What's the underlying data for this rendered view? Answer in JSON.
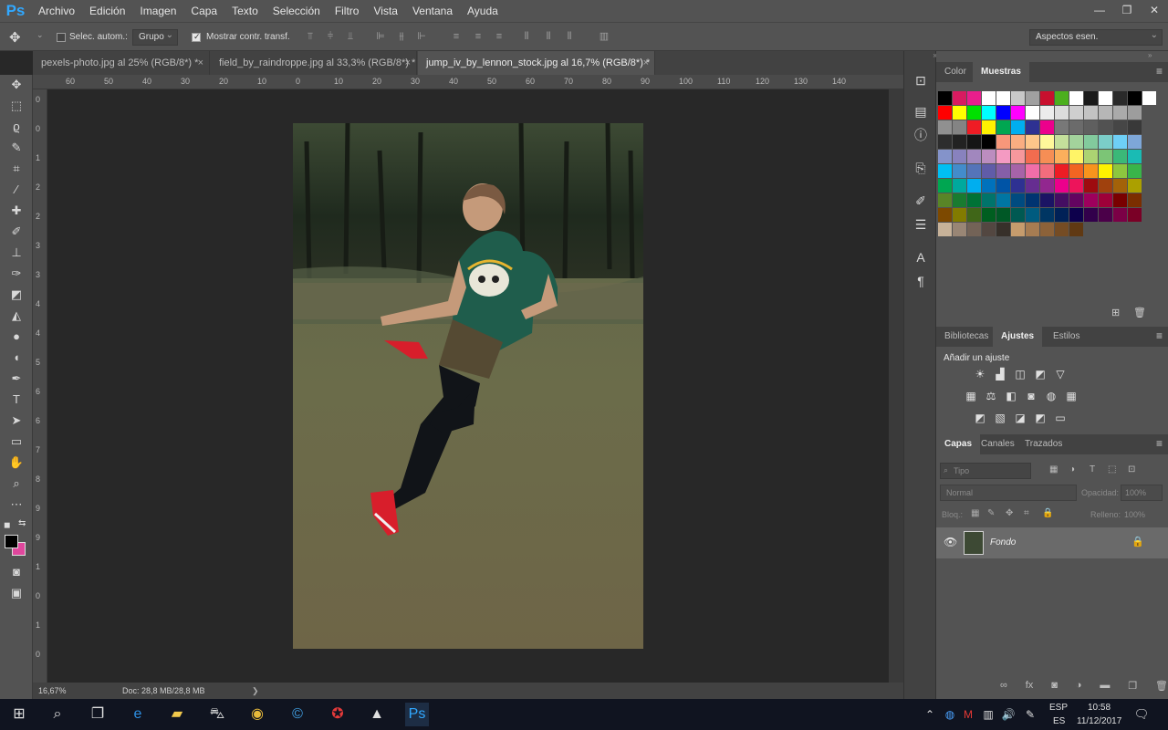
{
  "app": {
    "logo": "Ps",
    "menus": [
      "Archivo",
      "Edición",
      "Imagen",
      "Capa",
      "Texto",
      "Selección",
      "Filtro",
      "Vista",
      "Ventana",
      "Ayuda"
    ],
    "win_min": "—",
    "win_max": "❐",
    "win_close": "✕"
  },
  "options": {
    "auto_select_label": "Selec. autom.:",
    "auto_select_value": "Grupo",
    "show_transform_label": "Mostrar contr. transf.",
    "workspace": "Aspectos esen."
  },
  "tabs": [
    {
      "label": "pexels-photo.jpg al 25% (RGB/8*) *"
    },
    {
      "label": "field_by_raindroppe.jpg al 33,3% (RGB/8*) *"
    },
    {
      "label": "jump_iv_by_lennon_stock.jpg al 16,7% (RGB/8*) *"
    }
  ],
  "tab_close": "×",
  "ruler_h": [
    "60",
    "50",
    "40",
    "30",
    "20",
    "10",
    "0",
    "10",
    "20",
    "30",
    "40",
    "50",
    "60",
    "70",
    "80",
    "90",
    "100",
    "110",
    "120",
    "130",
    "140"
  ],
  "ruler_v": [
    "0",
    "0",
    "1",
    "2",
    "2",
    "3",
    "3",
    "4",
    "4",
    "5",
    "6",
    "6",
    "7",
    "8",
    "9",
    "9",
    "1",
    "0",
    "1",
    "0"
  ],
  "status": {
    "zoom": "16,67%",
    "doc": "Doc: 28,8 MB/28,8 MB",
    "arrow": "❯"
  },
  "colors": {
    "foreground": "#000000",
    "background": "#e0479d"
  },
  "swatches_panel": {
    "tabs": [
      "Color",
      "Muestras"
    ],
    "active": "Muestras"
  },
  "swatches": [
    [
      "#000000",
      "#d81b60",
      "#e91e8c",
      "#ffffff",
      "#ffffff",
      "#c8c8c8",
      "#a0a0a0",
      "#c8102e",
      "#4caf1e",
      "#ffffff",
      "#1a1a1a",
      "#ffffff",
      "#2a2a2a",
      "#000000",
      "#ffffff"
    ],
    [
      "#ff0000",
      "#ffff00",
      "#00e000",
      "#00ffff",
      "#0000ff",
      "#ff00ff",
      "#ffffff",
      "#ececec",
      "#dcdcdc",
      "#cfcfcf",
      "#c3c3c3",
      "#b6b6b6",
      "#aaaaaa",
      "#9d9d9d"
    ],
    [
      "#909090",
      "#848484",
      "#ef1c24",
      "#fff200",
      "#00a651",
      "#00aeef",
      "#2e3192",
      "#ec008c",
      "#787878",
      "#6b6b6b",
      "#5f5f5f",
      "#525252",
      "#464646",
      "#393939"
    ],
    [
      "#2d2d2d",
      "#222222",
      "#151515",
      "#000000",
      "#f7977a",
      "#f9ad81",
      "#fdc68a",
      "#fff79a",
      "#c4df9b",
      "#a3d39c",
      "#82ca9d",
      "#7bcdc8",
      "#6ecff6",
      "#7ea7d8"
    ],
    [
      "#8493ca",
      "#8882be",
      "#a187be",
      "#bc8dbf",
      "#f49ac2",
      "#f6989d",
      "#f26c4f",
      "#f68e55",
      "#fbaf5c",
      "#fff467",
      "#acd372",
      "#7cc576",
      "#3bb878",
      "#1abbb4"
    ],
    [
      "#00bff3",
      "#438ccb",
      "#5574b9",
      "#605ca8",
      "#855fa8",
      "#a763a8",
      "#f06ea9",
      "#f26d7d",
      "#ed1c24",
      "#f26522",
      "#f7941d",
      "#fff200",
      "#8dc63f",
      "#39b54a"
    ],
    [
      "#00a651",
      "#00a99d",
      "#00aeef",
      "#0072bc",
      "#0054a6",
      "#2e3192",
      "#662d91",
      "#92278f",
      "#ec008c",
      "#ed145b",
      "#9e0b0f",
      "#a0410d",
      "#a36209",
      "#aba000"
    ],
    [
      "#598527",
      "#197b30",
      "#007236",
      "#00746b",
      "#0076a3",
      "#004b80",
      "#003471",
      "#1b1464",
      "#440e62",
      "#630460",
      "#9e005d",
      "#9e0039",
      "#790000",
      "#7b2e00"
    ],
    [
      "#7d4900",
      "#827b00",
      "#406618",
      "#005e20",
      "#005826",
      "#005952",
      "#005b7f",
      "#003663",
      "#002157",
      "#0d004c",
      "#32004b",
      "#4b0049",
      "#7b0046",
      "#7a0026"
    ],
    [
      "#c7b299",
      "#998675",
      "#736357",
      "#534741",
      "#37302a",
      "#c69c6d",
      "#a67c52",
      "#8c6239",
      "#754c24",
      "#603913"
    ]
  ],
  "adjust_panel": {
    "tabs": [
      "Bibliotecas",
      "Ajustes",
      "Estilos"
    ],
    "active": "Ajustes",
    "heading": "Añadir un ajuste",
    "icons_row1": [
      "☀",
      "▟",
      "◫",
      "◩",
      "▽"
    ],
    "icons_row2": [
      "▦",
      "⚖",
      "◧",
      "◙",
      "◍",
      "▦"
    ],
    "icons_row3": [
      "◩",
      "▧",
      "◪",
      "◩",
      "▭"
    ]
  },
  "layers_panel": {
    "tabs": [
      "Capas",
      "Canales",
      "Trazados"
    ],
    "active": "Capas",
    "filter_placeholder": "Tipo",
    "blend_mode": "Normal",
    "opacity_label": "Opacidad:",
    "opacity_value": "100%",
    "lock_label": "Bloq.:",
    "fill_label": "Relleno:",
    "fill_value": "100%",
    "layer_name": "Fondo"
  },
  "panel_footer_icons": [
    "∞",
    "fx",
    "◙",
    "◑",
    "▬",
    "❐",
    "🗑"
  ],
  "taskbar": {
    "lang": "ESP",
    "lang2": "ES",
    "time": "10:58",
    "date": "11/12/2017"
  }
}
